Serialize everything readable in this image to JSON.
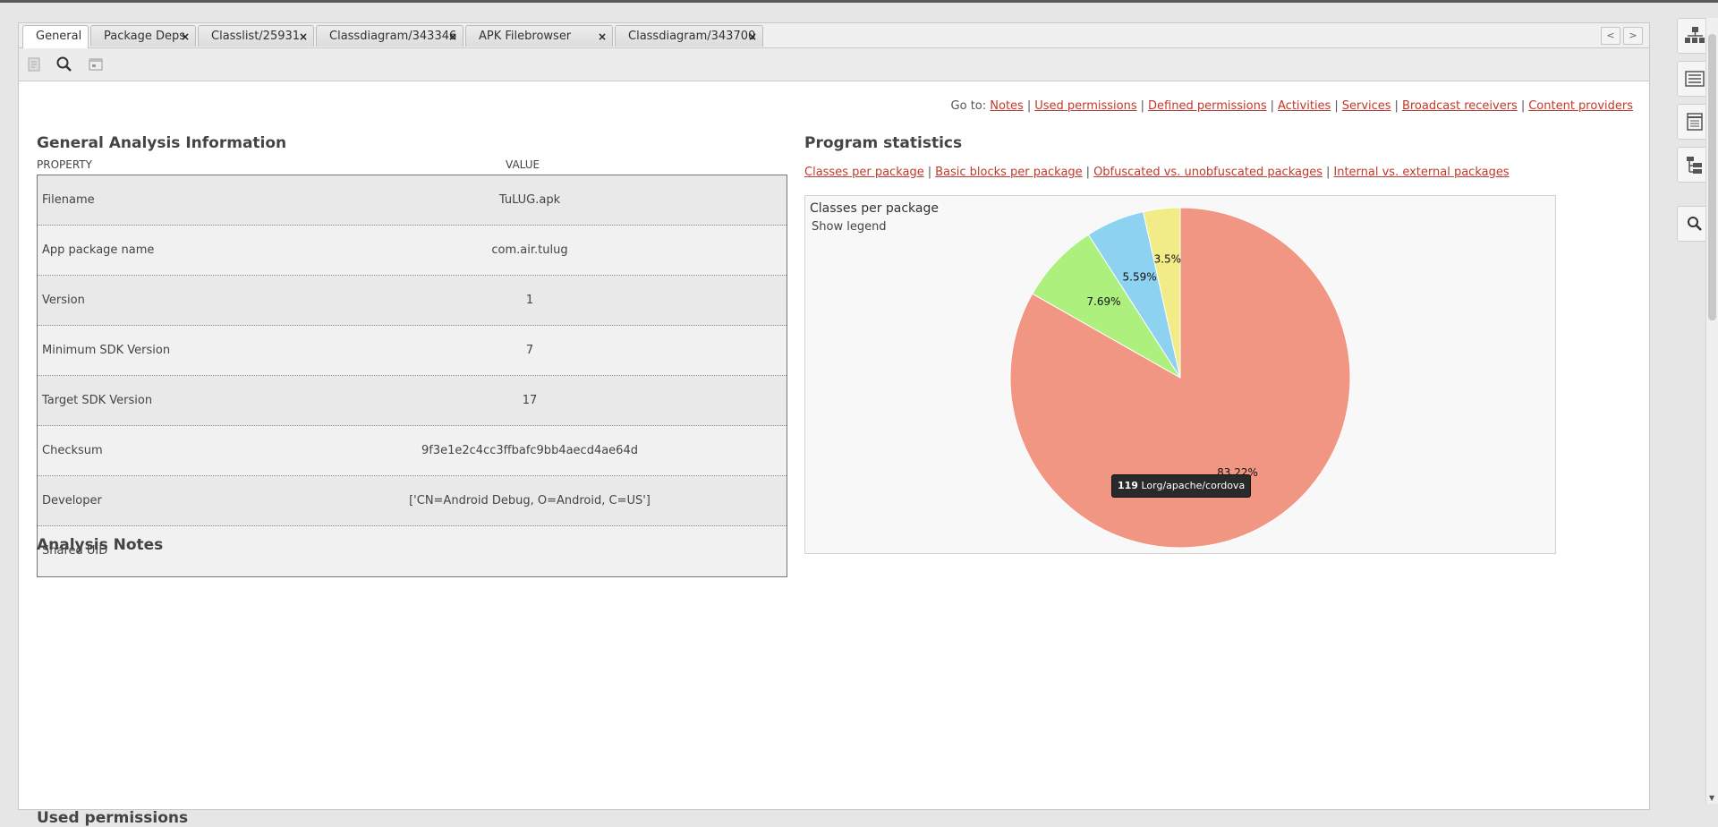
{
  "tabs": [
    {
      "label": "General",
      "closable": false,
      "active": true
    },
    {
      "label": "Package Deps",
      "closable": true
    },
    {
      "label": "Classlist/25931",
      "closable": true
    },
    {
      "label": "Classdiagram/343346",
      "closable": true
    },
    {
      "label": "APK Filebrowser",
      "closable": true
    },
    {
      "label": "Classdiagram/343700",
      "closable": true
    }
  ],
  "tab_close_glyph": "×",
  "nav": {
    "prev": "<",
    "next": ">"
  },
  "toolbar_icons": [
    "document-icon",
    "search-icon",
    "window-icon"
  ],
  "goto": {
    "label": "Go to:",
    "links": [
      "Notes",
      "Used permissions",
      "Defined permissions",
      "Activities",
      "Services",
      "Broadcast receivers",
      "Content providers"
    ],
    "separator": "|"
  },
  "general": {
    "title": "General Analysis Information",
    "col_property": "PROPERTY",
    "col_value": "VALUE",
    "rows": [
      {
        "property": "Filename",
        "value": "TuLUG.apk"
      },
      {
        "property": "App package name",
        "value": "com.air.tulug"
      },
      {
        "property": "Version",
        "value": "1"
      },
      {
        "property": "Minimum SDK Version",
        "value": "7"
      },
      {
        "property": "Target SDK Version",
        "value": "17"
      },
      {
        "property": "Checksum",
        "value": "9f3e1e2c4cc3ffbafc9bb4aecd4ae64d"
      },
      {
        "property": "Developer",
        "value": "['CN=Android Debug, O=Android, C=US']"
      },
      {
        "property": "Shared UID",
        "value": ""
      }
    ]
  },
  "stats": {
    "title": "Program statistics",
    "links": [
      "Classes per package",
      "Basic blocks per package",
      "Obfuscated vs. unobfuscated packages",
      "Internal vs. external packages"
    ],
    "separator": "|"
  },
  "notes_title": "Analysis Notes",
  "permissions_title": "Used permissions",
  "chart_data": {
    "type": "pie",
    "title": "Classes per package",
    "legend_toggle": "Show legend",
    "slices": [
      {
        "label": "83.22%",
        "value": 83.22,
        "color": "#f19682"
      },
      {
        "label": "7.69%",
        "value": 7.69,
        "color": "#adf07e"
      },
      {
        "label": "5.59%",
        "value": 5.59,
        "color": "#8dd2f0"
      },
      {
        "label": "3.5%",
        "value": 3.5,
        "color": "#f1ec87"
      }
    ],
    "tooltip": {
      "count": "119",
      "package": "Lorg/apache/cordova"
    }
  },
  "sidebar_icons": [
    "tree-icon",
    "list-icon",
    "calendar-icon",
    "hierarchy-icon",
    "search-icon"
  ],
  "scroll": {
    "up": "▲",
    "down": "▼"
  }
}
